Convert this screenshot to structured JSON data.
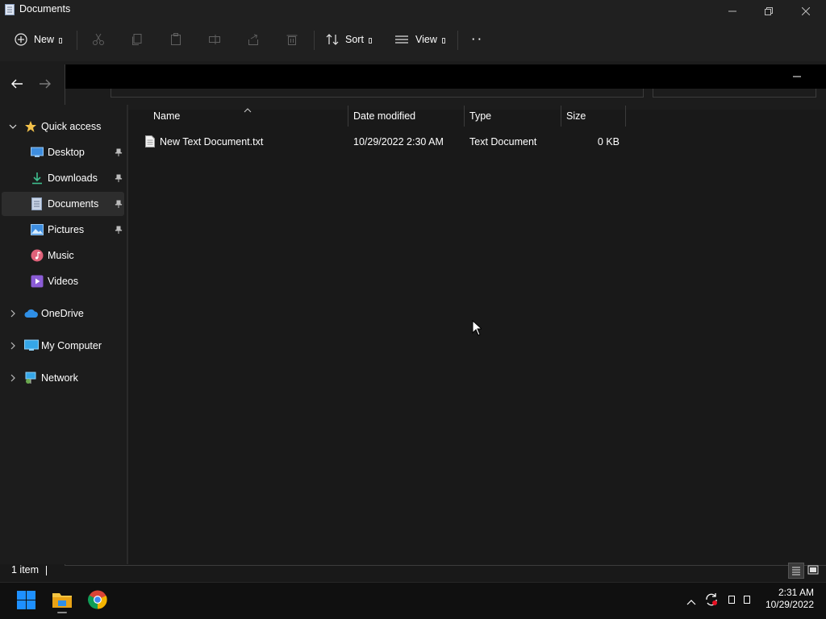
{
  "window": {
    "title": "Documents"
  },
  "toolbar": {
    "new_label": "New",
    "sort_label": "Sort",
    "view_label": "View",
    "more_label": "· ·"
  },
  "sidebar": {
    "items": [
      {
        "label": "Quick access",
        "icon": "star-icon"
      },
      {
        "label": "Desktop",
        "icon": "desktop-icon"
      },
      {
        "label": "Downloads",
        "icon": "download-icon"
      },
      {
        "label": "Documents",
        "icon": "documents-icon"
      },
      {
        "label": "Pictures",
        "icon": "pictures-icon"
      },
      {
        "label": "Music",
        "icon": "music-icon"
      },
      {
        "label": "Videos",
        "icon": "videos-icon"
      },
      {
        "label": "OneDrive",
        "icon": "cloud-icon"
      },
      {
        "label": "My Computer",
        "icon": "computer-icon"
      },
      {
        "label": "Network",
        "icon": "network-icon"
      }
    ]
  },
  "columns": {
    "name": "Name",
    "date": "Date modified",
    "type": "Type",
    "size": "Size"
  },
  "files": [
    {
      "name": "New Text Document.txt",
      "date": "10/29/2022 2:30 AM",
      "type": "Text Document",
      "size": "0 KB"
    }
  ],
  "status": {
    "count": "1 item"
  },
  "taskbar": {
    "time": "2:31 AM",
    "date": "10/29/2022"
  },
  "colors": {
    "accent": "#0a84ff",
    "star": "#f2c14a",
    "folder": "#f4c542"
  }
}
